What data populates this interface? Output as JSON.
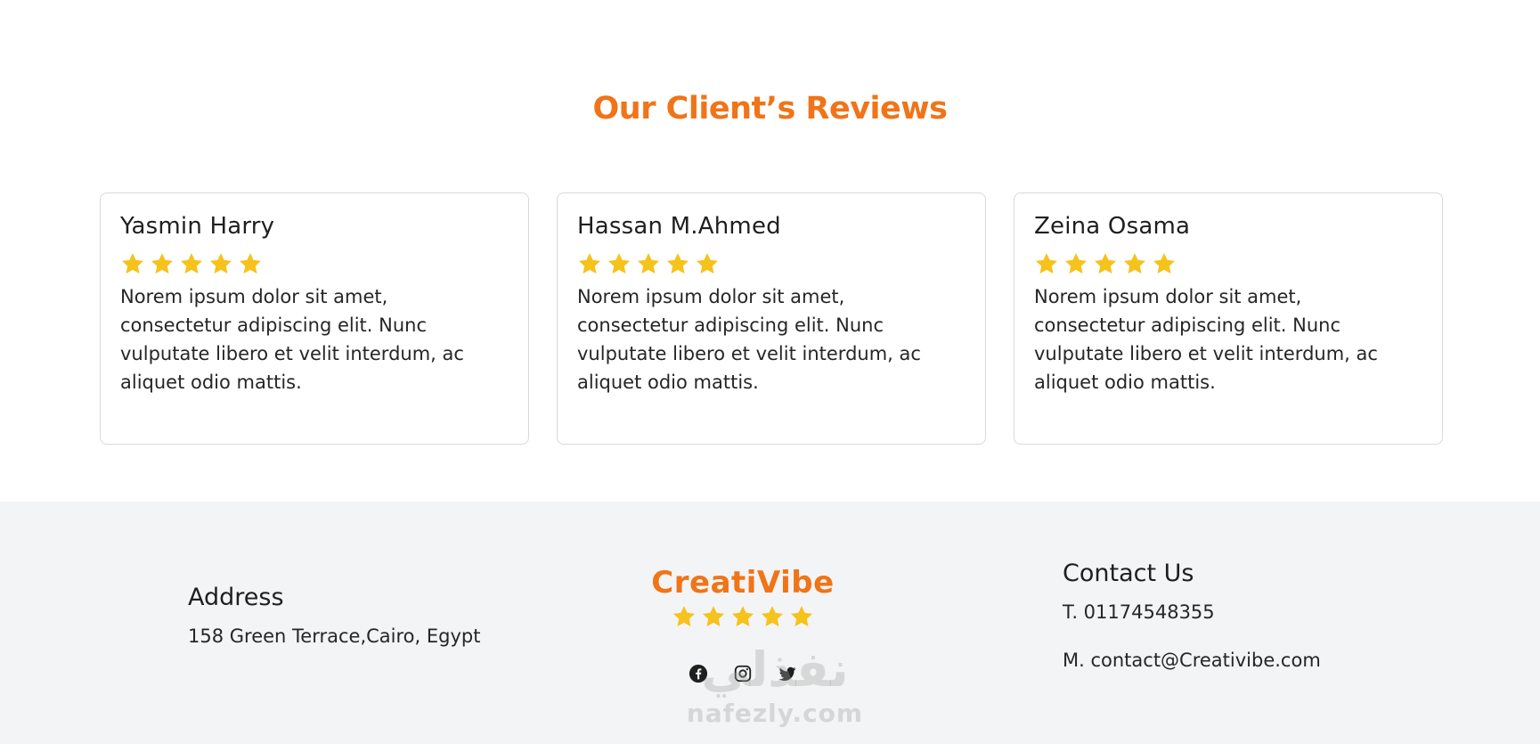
{
  "reviews": {
    "title": "Our Client’s Reviews",
    "cards": [
      {
        "name": "Yasmin Harry",
        "rating": 5,
        "text": "Norem ipsum dolor sit amet, consectetur adipiscing elit. Nunc vulputate libero et velit interdum, ac aliquet odio mattis."
      },
      {
        "name": "Hassan M.Ahmed",
        "rating": 5,
        "text": "Norem ipsum dolor sit amet, consectetur adipiscing elit. Nunc vulputate libero et velit interdum, ac aliquet odio mattis."
      },
      {
        "name": "Zeina Osama",
        "rating": 5,
        "text": "Norem ipsum dolor sit amet, consectetur adipiscing elit. Nunc vulputate libero et velit interdum, ac aliquet odio mattis."
      }
    ]
  },
  "footer": {
    "address": {
      "heading": "Address",
      "line": "158 Green Terrace,Cairo, Egypt"
    },
    "brand": {
      "name": "CreatiVibe",
      "rating": 5
    },
    "socials": [
      {
        "icon": "facebook-icon"
      },
      {
        "icon": "instagram-icon"
      },
      {
        "icon": "twitter-icon"
      }
    ],
    "contact": {
      "heading": "Contact Us",
      "phone": "T. 01174548355",
      "email": "M. contact@Creativibe.com"
    }
  },
  "watermark": {
    "mark": "نفذلي",
    "text": "nafezly.com"
  },
  "colors": {
    "accent": "#f07418",
    "star": "#f6c21c",
    "footer_bg": "#f3f4f5",
    "card_border": "#d9d9d9"
  }
}
